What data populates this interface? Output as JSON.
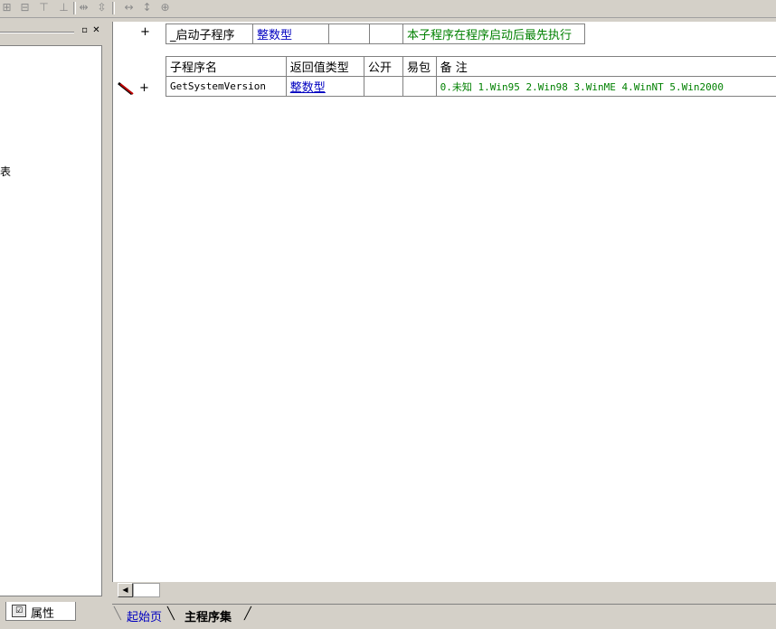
{
  "toolbar": {
    "icons": [
      "align-left-icon",
      "align-center-icon",
      "align-top-icon",
      "align-bottom-icon",
      "same-width-icon",
      "same-height-icon",
      "h-space-icon",
      "v-space-icon",
      "center-icon"
    ]
  },
  "left_panel": {
    "partial_item": "表",
    "tab_label": "属性"
  },
  "startup_row": {
    "plus": "+",
    "name": "_启动子程序",
    "type": "整数型",
    "remark": "本子程序在程序启动后最先执行"
  },
  "sub_table": {
    "headers": {
      "name": "子程序名",
      "return_type": "返回值类型",
      "public": "公开",
      "package": "易包",
      "remark": "备 注"
    },
    "row": {
      "plus": "+",
      "name": "GetSystemVersion",
      "type": "整数型",
      "remark": "0.未知 1.Win95 2.Win98 3.WinME 4.WinNT 5.Win2000"
    }
  },
  "doc_tabs": {
    "start": "起始页",
    "main": "主程序集"
  }
}
